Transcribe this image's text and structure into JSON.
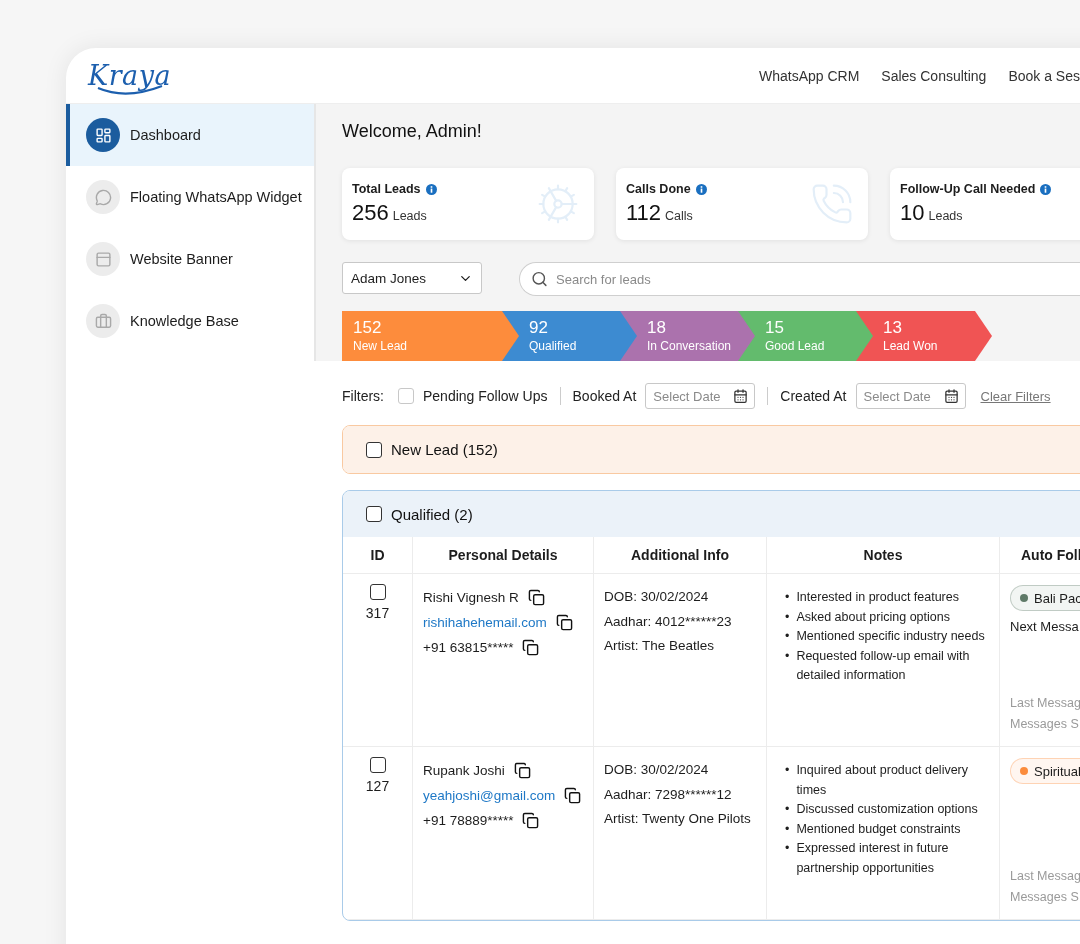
{
  "header": {
    "logo": "Kraya",
    "nav": [
      "WhatsApp CRM",
      "Sales Consulting",
      "Book a Ses"
    ]
  },
  "sidebar": {
    "items": [
      {
        "label": "Dashboard",
        "kind": "dashboard",
        "selected": true
      },
      {
        "label": "Floating WhatsApp Widget",
        "kind": "whatsapp",
        "selected": false
      },
      {
        "label": "Website Banner",
        "kind": "banner",
        "selected": false
      },
      {
        "label": "Knowledge Base",
        "kind": "knowledge",
        "selected": false
      }
    ]
  },
  "welcome": "Welcome, Admin!",
  "stats": [
    {
      "title": "Total Leads",
      "value": "256",
      "unit": "Leads",
      "kind": "leads"
    },
    {
      "title": "Calls Done",
      "value": "112",
      "unit": "Calls",
      "kind": "calls"
    },
    {
      "title": "Follow-Up Call Needed",
      "value": "10",
      "unit": "Leads",
      "kind": "followup"
    }
  ],
  "agent_select": {
    "value": "Adam Jones"
  },
  "search": {
    "placeholder": "Search for leads"
  },
  "funnel": [
    {
      "count": "152",
      "label": "New Lead",
      "color": "#fd8c3c"
    },
    {
      "count": "92",
      "label": "Qualified",
      "color": "#3d8bd1"
    },
    {
      "count": "18",
      "label": "In Conversation",
      "color": "#ab72ad"
    },
    {
      "count": "15",
      "label": "Good Lead",
      "color": "#63bb6d"
    },
    {
      "count": "13",
      "label": "Lead Won",
      "color": "#f05454"
    }
  ],
  "filters": {
    "label": "Filters:",
    "pending": {
      "label": "Pending Follow Ups",
      "checked": false
    },
    "booked": {
      "label": "Booked At",
      "placeholder": "Select Date"
    },
    "created": {
      "label": "Created At",
      "placeholder": "Select Date"
    },
    "clear": "Clear Filters"
  },
  "groups": [
    {
      "title": "New Lead (152)",
      "kind": "new",
      "checked": false,
      "expanded": false
    },
    {
      "title": "Qualified (2)",
      "kind": "qualified",
      "checked": false,
      "expanded": true,
      "columns": [
        "ID",
        "Personal Details",
        "Additional Info",
        "Notes",
        "Auto Foll"
      ],
      "note_marker": "•",
      "rows": [
        {
          "id": "317",
          "checked": false,
          "name": "Rishi Vignesh R",
          "email": "rishihahehemail.com",
          "phone": "+91 63815*****",
          "info": [
            "DOB: 30/02/2024",
            "Aadhar: 4012******23",
            "Artist: The Beatles"
          ],
          "notes": [
            "Interested in product features",
            "Asked about pricing options",
            "Mentioned specific industry needs",
            "Requested follow-up email with detailed information"
          ],
          "followup": {
            "tag": "Bali Pac",
            "color": "#5f7a68",
            "next": "Next Messa",
            "last": "Last Messag",
            "sent": "Messages S"
          }
        },
        {
          "id": "127",
          "checked": false,
          "name": "Rupank Joshi",
          "email": "yeahjoshi@gmail.com",
          "phone": "+91 78889*****",
          "info": [
            "DOB: 30/02/2024",
            "Aadhar: 7298******12",
            "Artist: Twenty One Pilots"
          ],
          "notes": [
            "Inquired about product delivery times",
            "Discussed customization options",
            "Mentioned budget constraints",
            "Expressed interest in future partnership opportunities"
          ],
          "followup": {
            "tag": "Spiritual",
            "color": "#fb8c3c",
            "last": "Last Messag",
            "sent": "Messages S"
          }
        }
      ]
    }
  ]
}
